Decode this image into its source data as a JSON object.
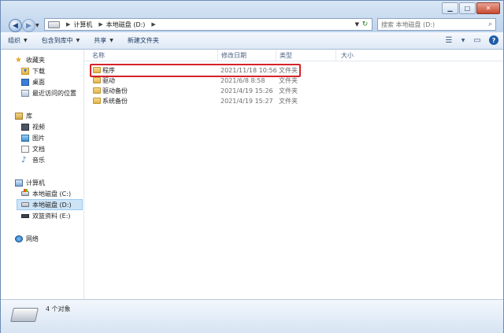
{
  "address_bar": {
    "segments": [
      "计算机",
      "本地磁盘 (D:)"
    ]
  },
  "search": {
    "placeholder": "搜索 本地磁盘 (D:)"
  },
  "toolbar": {
    "organize": "组织",
    "include_in_library": "包含到库中",
    "share": "共享",
    "new_folder": "新建文件夹"
  },
  "nav": {
    "favorites": "收藏夹",
    "downloads": "下载",
    "desktop": "桌面",
    "recent": "最近访问的位置",
    "libraries": "库",
    "videos": "视频",
    "pictures": "图片",
    "documents": "文档",
    "music": "音乐",
    "computer": "计算机",
    "drive_c": "本地磁盘 (C:)",
    "drive_d": "本地磁盘 (D:)",
    "drive_e": "双篮资料 (E:)",
    "network": "网络"
  },
  "columns": {
    "name": "名称",
    "date": "修改日期",
    "type": "类型",
    "size": "大小"
  },
  "files": [
    {
      "name": "程序",
      "date": "2021/11/18 10:56",
      "type": "文件夹"
    },
    {
      "name": "驱动",
      "date": "2021/6/8 8:58",
      "type": "文件夹"
    },
    {
      "name": "驱动备份",
      "date": "2021/4/19 15:26",
      "type": "文件夹"
    },
    {
      "name": "系统备份",
      "date": "2021/4/19 15:27",
      "type": "文件夹"
    }
  ],
  "status": {
    "object_count": "4 个对象"
  },
  "colors": {
    "highlight": "#d62229",
    "selection": "#cde4f7"
  }
}
